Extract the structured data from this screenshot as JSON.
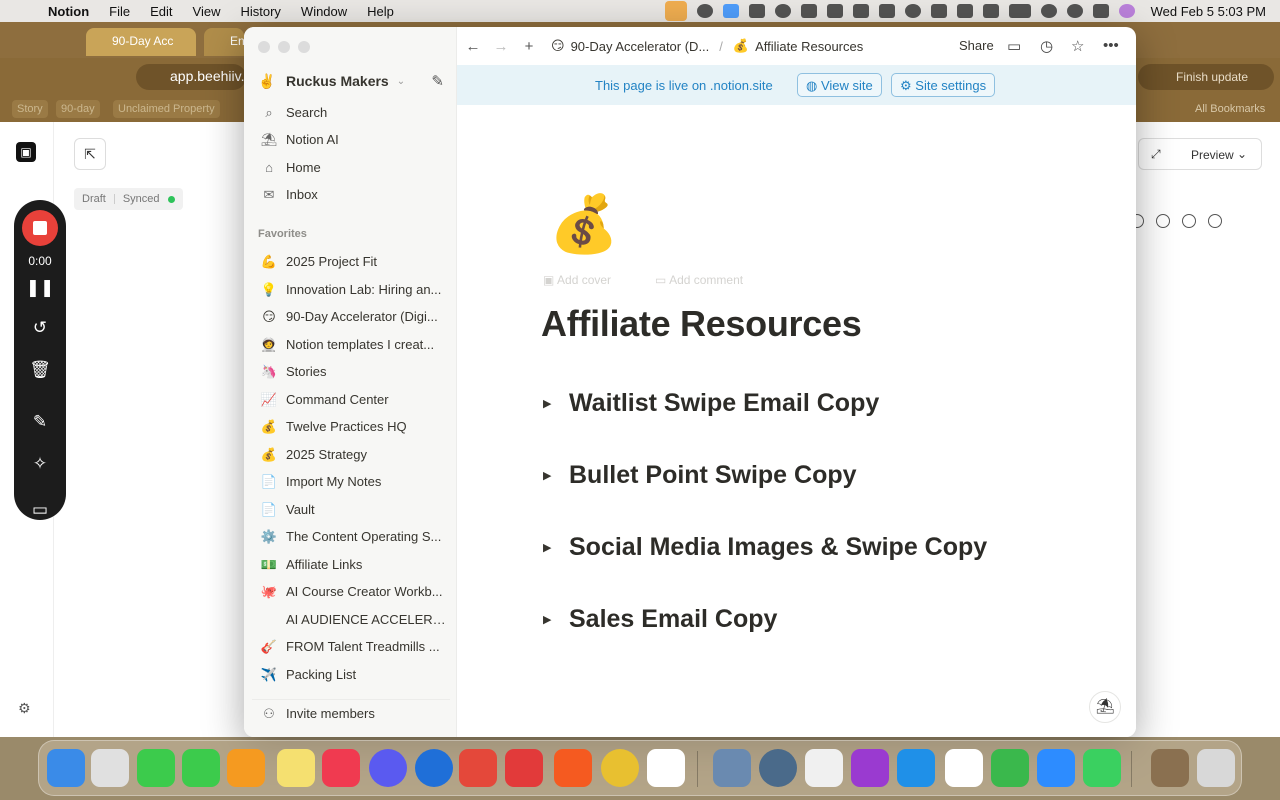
{
  "menubar": {
    "app_name": "Notion",
    "items": [
      "File",
      "Edit",
      "View",
      "History",
      "Window",
      "Help"
    ],
    "clock": "Wed Feb 5  5:03 PM"
  },
  "chrome": {
    "tab_active": "90-Day Acc",
    "tab_second": "En",
    "url": "app.beehiiv.",
    "finish_update": "Finish update",
    "bookmarks": [
      "Story",
      "90-day",
      "Unclaimed Property"
    ],
    "all_bookmarks": "All Bookmarks",
    "draft": "Draft",
    "synced": "Synced",
    "preview": "Preview"
  },
  "recorder": {
    "time": "0:00"
  },
  "notion": {
    "workspace": "Ruckus Makers",
    "workspace_emoji": "✌️",
    "nav": [
      {
        "label": "Search",
        "icon": "⌕"
      },
      {
        "label": "Notion AI",
        "icon": "⛱"
      },
      {
        "label": "Home",
        "icon": "⌂"
      },
      {
        "label": "Inbox",
        "icon": "✉"
      }
    ],
    "favorites_label": "Favorites",
    "favorites": [
      {
        "label": "2025 Project Fit",
        "emoji": "💪"
      },
      {
        "label": "Innovation Lab: Hiring an...",
        "emoji": "💡"
      },
      {
        "label": "90-Day Accelerator (Digi...",
        "emoji": "😏"
      },
      {
        "label": "Notion templates I creat...",
        "emoji": "🧑‍🚀"
      },
      {
        "label": "Stories",
        "emoji": "🦄"
      },
      {
        "label": "Command Center",
        "emoji": "📈"
      },
      {
        "label": "Twelve Practices HQ",
        "emoji": "💰"
      },
      {
        "label": "2025 Strategy",
        "emoji": "💰"
      },
      {
        "label": "Import My Notes",
        "emoji": "📄"
      },
      {
        "label": "Vault",
        "emoji": "📄"
      },
      {
        "label": "The Content Operating S...",
        "emoji": "⚙️"
      },
      {
        "label": "Affiliate Links",
        "emoji": "💵"
      },
      {
        "label": "AI Course Creator Workb...",
        "emoji": "🐙"
      },
      {
        "label": "AI AUDIENCE ACCELERA...",
        "emoji": ""
      },
      {
        "label": "FROM Talent Treadmills ...",
        "emoji": "🎸"
      },
      {
        "label": "Packing List",
        "emoji": "✈️"
      }
    ],
    "invite": "Invite members",
    "breadcrumb_parent": "90-Day Accelerator (D...",
    "breadcrumb_parent_emoji": "😏",
    "breadcrumb_current": "Affiliate Resources",
    "breadcrumb_current_emoji": "💰",
    "share": "Share",
    "banner_msg": "This page is live on .notion.site",
    "view_site": "View site",
    "site_settings": "Site settings",
    "page_icon": "💰",
    "add_cover": "Add cover",
    "add_comment": "Add comment",
    "title": "Affiliate Resources",
    "toggles": [
      "Waitlist Swipe Email Copy",
      "Bullet Point Swipe Copy",
      "Social Media Images & Swipe Copy",
      "Sales Email Copy"
    ]
  }
}
